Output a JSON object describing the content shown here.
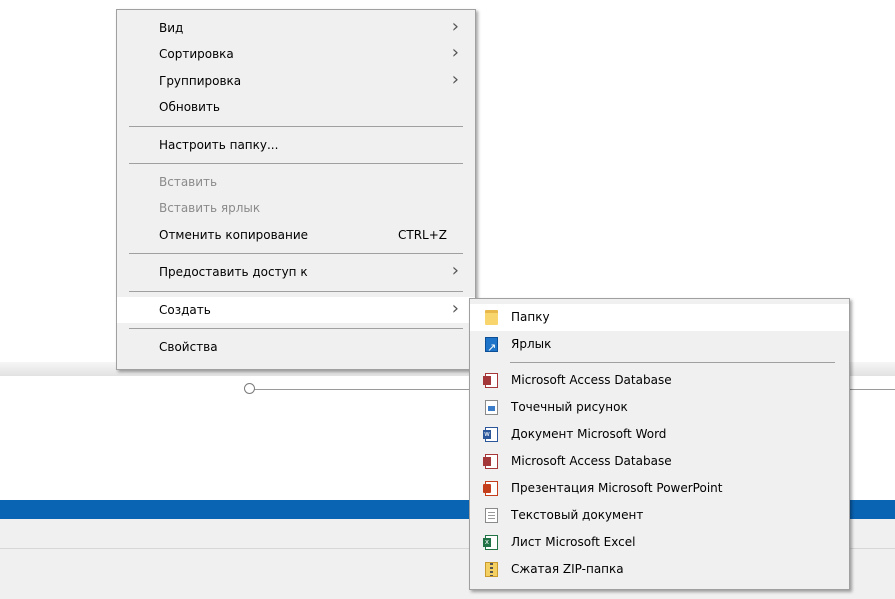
{
  "context_menu": {
    "items": [
      {
        "label": "Вид",
        "arrow": "›"
      },
      {
        "label": "Сортировка",
        "arrow": "›"
      },
      {
        "label": "Группировка",
        "arrow": "›"
      },
      {
        "label": "Обновить"
      },
      {
        "label": "Настроить папку..."
      },
      {
        "label": "Вставить",
        "disabled": true
      },
      {
        "label": "Вставить ярлык",
        "disabled": true
      },
      {
        "label": "Отменить копирование",
        "shortcut": "CTRL+Z"
      },
      {
        "label": "Предоставить доступ к",
        "arrow": "›"
      },
      {
        "label": "Создать",
        "arrow": "›",
        "highlighted": true
      },
      {
        "label": "Свойства"
      }
    ]
  },
  "create_submenu": {
    "items": [
      {
        "label": "Папку",
        "icon": "folder-icon"
      },
      {
        "label": "Ярлык",
        "icon": "shortcut-icon"
      },
      {
        "label": "Microsoft Access Database",
        "icon": "access-icon"
      },
      {
        "label": "Точечный рисунок",
        "icon": "bitmap-icon"
      },
      {
        "label": "Документ Microsoft Word",
        "icon": "word-icon"
      },
      {
        "label": "Microsoft Access Database",
        "icon": "access-icon"
      },
      {
        "label": "Презентация Microsoft PowerPoint",
        "icon": "powerpoint-icon"
      },
      {
        "label": "Текстовый документ",
        "icon": "text-document-icon"
      },
      {
        "label": "Лист Microsoft Excel",
        "icon": "excel-icon"
      },
      {
        "label": "Сжатая ZIP-папка",
        "icon": "zip-folder-icon"
      }
    ]
  },
  "colors": {
    "menu_bg": "#f0f0f0",
    "highlight_bg": "#ffffff",
    "taskbar_blue": "#0a64b4",
    "disabled_text": "#8b8b8b"
  }
}
